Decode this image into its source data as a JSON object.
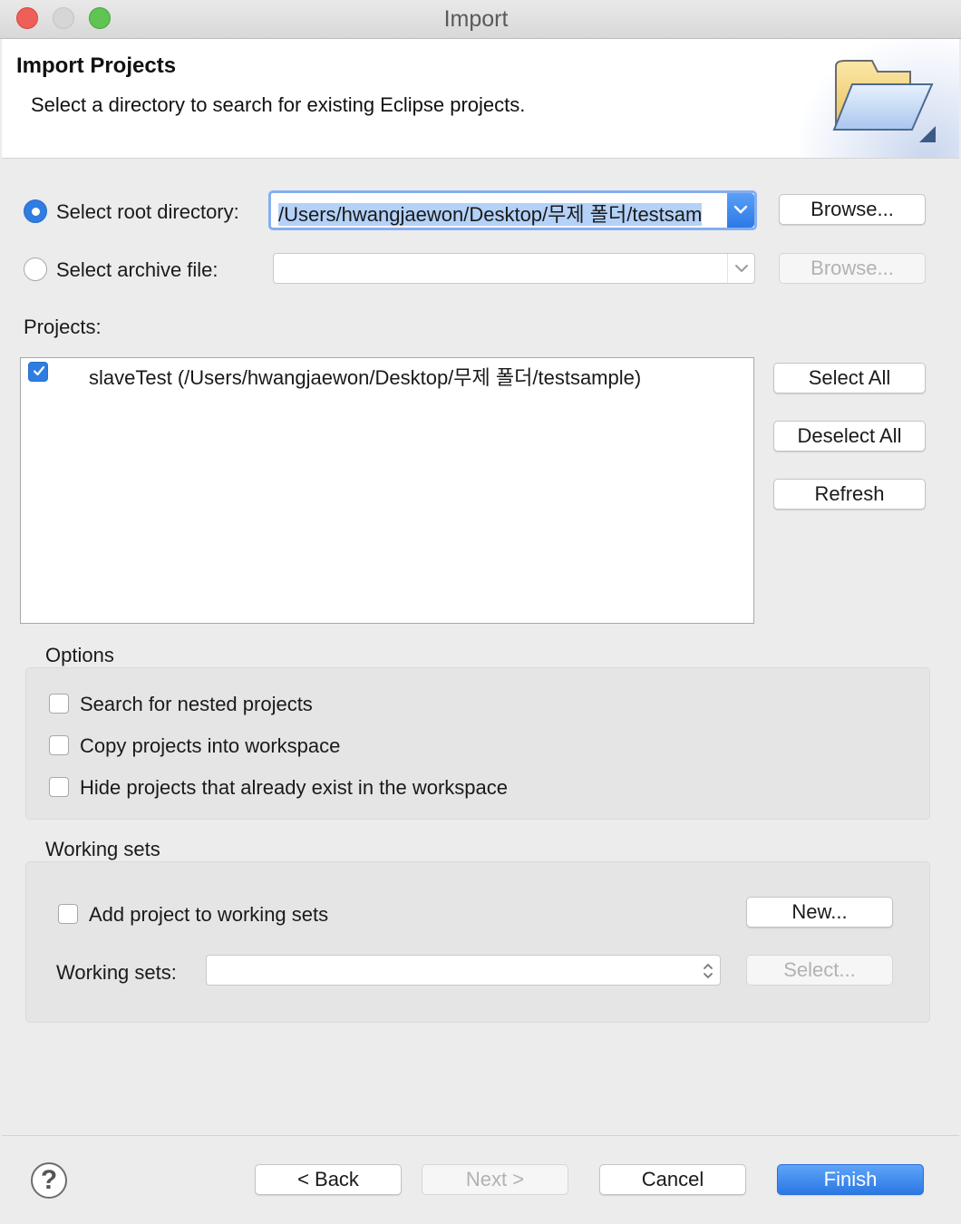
{
  "window": {
    "title": "Import"
  },
  "header": {
    "title": "Import Projects",
    "description": "Select a directory to search for existing Eclipse projects.",
    "banner_icon": "folder-icon"
  },
  "source": {
    "root_dir_label": "Select root directory:",
    "root_dir_selected": true,
    "root_dir_value": "/Users/hwangjaewon/Desktop/무제 폴더/testsam",
    "archive_label": "Select archive file:",
    "archive_selected": false,
    "archive_value": "",
    "browse_label": "Browse..."
  },
  "projects": {
    "label": "Projects:",
    "items": [
      {
        "checked": true,
        "label": "slaveTest (/Users/hwangjaewon/Desktop/무제 폴더/testsample)"
      }
    ],
    "select_all": "Select All",
    "deselect_all": "Deselect All",
    "refresh": "Refresh"
  },
  "options": {
    "title": "Options",
    "items": [
      {
        "label": "Search for nested projects",
        "checked": false
      },
      {
        "label": "Copy projects into workspace",
        "checked": false
      },
      {
        "label": "Hide projects that already exist in the workspace",
        "checked": false
      }
    ]
  },
  "working_sets": {
    "title": "Working sets",
    "add_label": "Add project to working sets",
    "add_checked": false,
    "new_label": "New...",
    "sets_label": "Working sets:",
    "sets_value": "",
    "select_label": "Select..."
  },
  "footer": {
    "help_glyph": "?",
    "back": "< Back",
    "next": "Next >",
    "cancel": "Cancel",
    "finish": "Finish"
  },
  "colors": {
    "accent": "#2f7de1",
    "selection": "#b4d1f7"
  }
}
